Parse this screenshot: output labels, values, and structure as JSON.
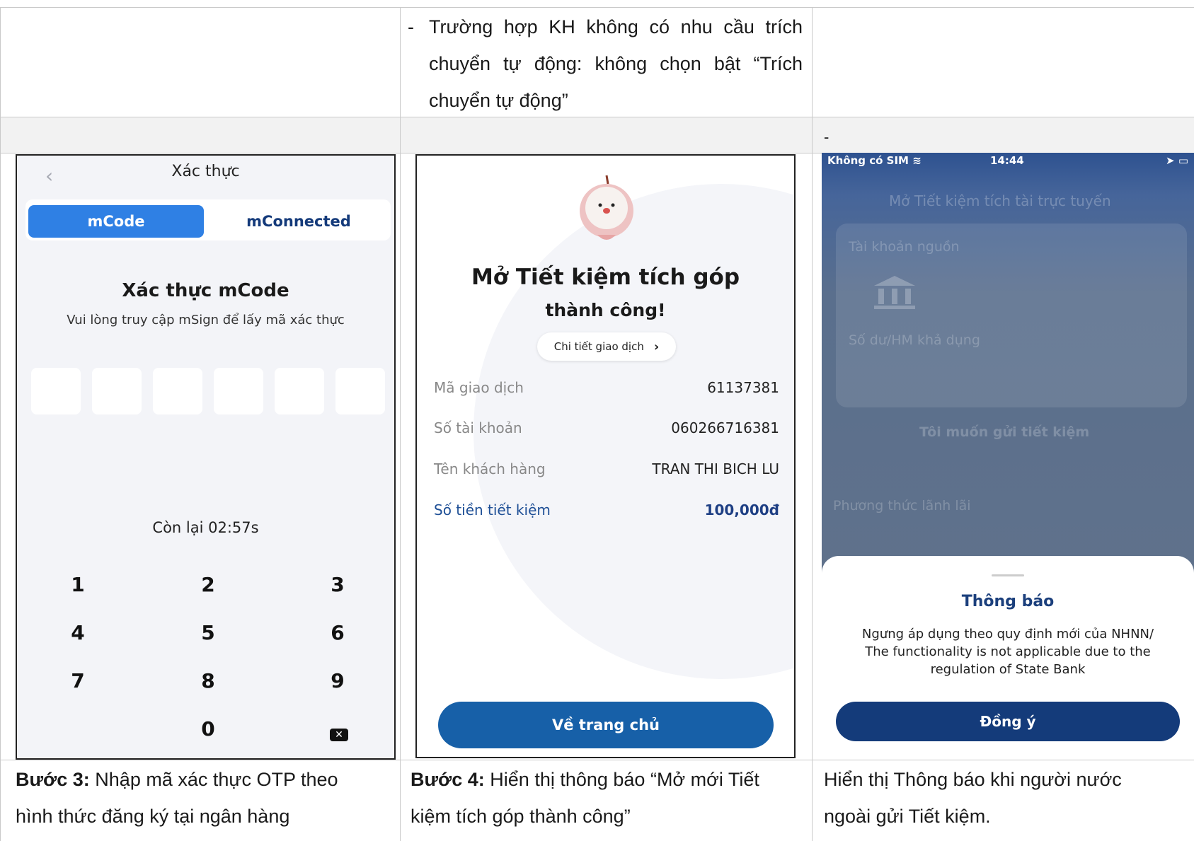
{
  "top_row": {
    "bullet": "-",
    "note_lines": [
      "Trường hợp KH không có nhu cầu trích",
      "chuyển tự động: không chọn bật “Trích",
      "chuyển tự động”"
    ]
  },
  "gray_row_dash": "-",
  "screen1": {
    "back_icon": "chevron-left-icon",
    "title": "Xác thực",
    "tab_active": "mCode",
    "tab_other": "mConnected",
    "heading": "Xác thực mCode",
    "subtitle": "Vui lòng truy cập mSign để lấy mã xác thực",
    "timer": "Còn lại 02:57s",
    "keys": [
      "1",
      "2",
      "3",
      "4",
      "5",
      "6",
      "7",
      "8",
      "9",
      "0"
    ]
  },
  "screen2": {
    "heading1": "Mở Tiết kiệm tích góp",
    "heading2": "thành công!",
    "detail_button": "Chi tiết giao dịch",
    "rows": [
      {
        "label": "Mã giao dịch",
        "value": "61137381"
      },
      {
        "label": "Số tài khoản",
        "value": "060266716381"
      },
      {
        "label": "Tên khách hàng",
        "value": "TRAN THI BICH LU"
      },
      {
        "label": "Số tiền tiết kiệm",
        "value": "100,000đ"
      }
    ],
    "home_button": "Về trang chủ"
  },
  "screen3": {
    "status_left": "Không có SIM",
    "status_time": "14:44",
    "nav_title": "Mở Tiết kiệm tích tài trực tuyến",
    "source_label": "Tài khoản nguồn",
    "balance_label": "Số dư/HM khả dụng",
    "want_label": "Tôi muốn gửi tiết kiệm",
    "method_label": "Phương thức lãnh lãi",
    "modal_title": "Thông báo",
    "modal_message": [
      "Ngưng áp dụng theo quy định mới của NHNN/",
      "The functionality is not applicable due to the",
      "regulation of State Bank"
    ],
    "modal_button": "Đồng ý"
  },
  "captions": {
    "col1_bold": "Bước 3:",
    "col1_text_l1": " Nhập mã xác thực OTP theo",
    "col1_text_l2": "hình thức đăng ký tại ngân hàng",
    "col2_bold": "Bước 4:",
    "col2_text_l1": " Hiển thị thông báo “Mở mới Tiết",
    "col2_text_l2": "kiệm tích góp thành công”",
    "col3_text_l1": "Hiển thị Thông báo khi người nước",
    "col3_text_l2": "ngoài gửi Tiết kiệm."
  }
}
